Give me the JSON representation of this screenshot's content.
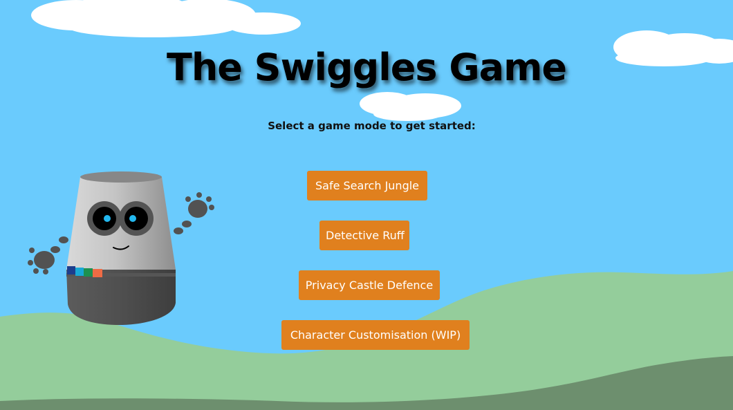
{
  "title": "The Swiggles Game",
  "subtitle": "Select a game mode to get started:",
  "buttons": {
    "safe_search": "Safe Search Jungle",
    "detective": "Detective Ruff",
    "privacy": "Privacy Castle Defence",
    "character": "Character Customisation (WIP)"
  },
  "colors": {
    "sky": "#6acbfd",
    "hill_light": "#94cd9b",
    "hill_dark": "#6d8f6e",
    "button": "#e0801e",
    "button_text": "#ffffff",
    "cloud": "#ffffff"
  },
  "mascot": {
    "name": "smart-speaker-mascot",
    "stripe_colors": [
      "#1c3e8e",
      "#19a9d6",
      "#1d9150",
      "#ef6b45"
    ]
  }
}
